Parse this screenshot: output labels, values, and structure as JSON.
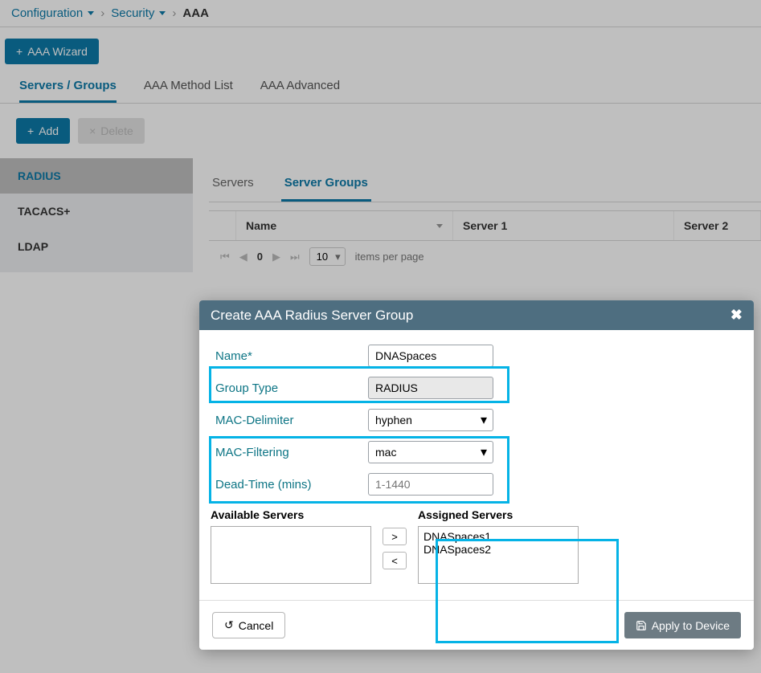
{
  "breadcrumb": {
    "a": "Configuration",
    "b": "Security",
    "c": "AAA"
  },
  "topbar": {
    "wizard": "AAA Wizard"
  },
  "main_tabs": {
    "servers_groups": "Servers / Groups",
    "method_list": "AAA Method List",
    "advanced": "AAA Advanced"
  },
  "actions": {
    "add": "Add",
    "delete": "Delete"
  },
  "sidebar": {
    "radius": "RADIUS",
    "tacacs": "TACACS+",
    "ldap": "LDAP"
  },
  "sub_tabs": {
    "servers": "Servers",
    "server_groups": "Server Groups"
  },
  "table": {
    "name": "Name",
    "s1": "Server 1",
    "s2": "Server 2"
  },
  "pager": {
    "count": "0",
    "page_size": "10",
    "ipp": "items per page"
  },
  "modal": {
    "title": "Create AAA Radius Server Group",
    "name_label": "Name*",
    "name_value": "DNASpaces",
    "group_type_label": "Group Type",
    "group_type_value": "RADIUS",
    "mac_delim_label": "MAC-Delimiter",
    "mac_delim_value": "hyphen",
    "mac_filter_label": "MAC-Filtering",
    "mac_filter_value": "mac",
    "dead_time_label": "Dead-Time (mins)",
    "dead_time_placeholder": "1-1440",
    "available_label": "Available Servers",
    "assigned_label": "Assigned Servers",
    "assigned": [
      "DNASpaces1",
      "DNASpaces2"
    ],
    "cancel": "Cancel",
    "apply": "Apply to Device",
    "move_right": ">",
    "move_left": "<"
  }
}
